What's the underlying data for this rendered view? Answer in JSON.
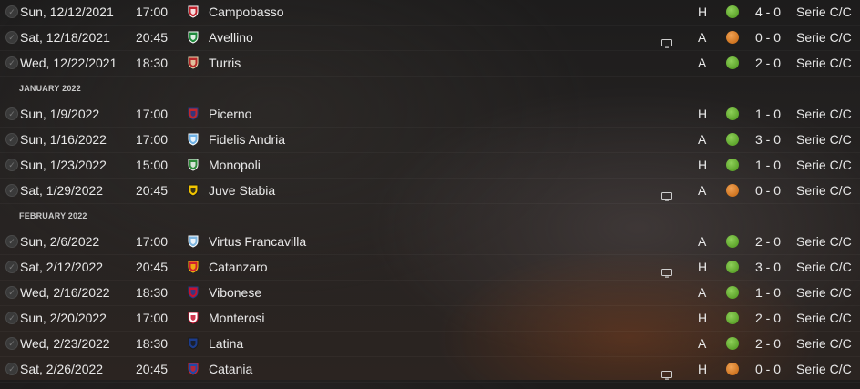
{
  "fixtures": [
    {
      "type": "match",
      "date": "Sun, 12/12/2021",
      "time": "17:00",
      "team": "Campobasso",
      "crest": "crest-campobasso",
      "crest_colors": [
        "#c0222c",
        "#ffffff"
      ],
      "tv": false,
      "venue": "H",
      "result": "win",
      "score": "4 - 0",
      "competition": "Serie C/C"
    },
    {
      "type": "match",
      "date": "Sat, 12/18/2021",
      "time": "20:45",
      "team": "Avellino",
      "crest": "crest-avellino",
      "crest_colors": [
        "#1f8a3c",
        "#ffffff"
      ],
      "tv": true,
      "venue": "A",
      "result": "draw",
      "score": "0 - 0",
      "competition": "Serie C/C"
    },
    {
      "type": "match",
      "date": "Wed, 12/22/2021",
      "time": "18:30",
      "team": "Turris",
      "crest": "crest-turris",
      "crest_colors": [
        "#b52a2a",
        "#e8d9b0"
      ],
      "tv": false,
      "venue": "A",
      "result": "win",
      "score": "2 - 0",
      "competition": "Serie C/C"
    },
    {
      "type": "month",
      "label": "JANUARY 2022"
    },
    {
      "type": "match",
      "date": "Sun, 1/9/2022",
      "time": "17:00",
      "team": "Picerno",
      "crest": "crest-picerno",
      "crest_colors": [
        "#c1272d",
        "#1e3a8a"
      ],
      "tv": false,
      "venue": "H",
      "result": "win",
      "score": "1 - 0",
      "competition": "Serie C/C"
    },
    {
      "type": "match",
      "date": "Sun, 1/16/2022",
      "time": "17:00",
      "team": "Fidelis Andria",
      "crest": "crest-fidelis-andria",
      "crest_colors": [
        "#6fb2e6",
        "#ffffff"
      ],
      "tv": false,
      "venue": "A",
      "result": "win",
      "score": "3 - 0",
      "competition": "Serie C/C"
    },
    {
      "type": "match",
      "date": "Sun, 1/23/2022",
      "time": "15:00",
      "team": "Monopoli",
      "crest": "crest-monopoli",
      "crest_colors": [
        "#2e8b3a",
        "#f2f2f2"
      ],
      "tv": false,
      "venue": "H",
      "result": "win",
      "score": "1 - 0",
      "competition": "Serie C/C"
    },
    {
      "type": "match",
      "date": "Sat, 1/29/2022",
      "time": "20:45",
      "team": "Juve Stabia",
      "crest": "crest-juve-stabia",
      "crest_colors": [
        "#f2c500",
        "#1a1a1a"
      ],
      "tv": true,
      "venue": "A",
      "result": "draw",
      "score": "0 - 0",
      "competition": "Serie C/C"
    },
    {
      "type": "month",
      "label": "FEBRUARY 2022"
    },
    {
      "type": "match",
      "date": "Sun, 2/6/2022",
      "time": "17:00",
      "team": "Virtus Francavilla",
      "crest": "crest-virtus-francavilla",
      "crest_colors": [
        "#7fb6e0",
        "#ffffff"
      ],
      "tv": false,
      "venue": "A",
      "result": "win",
      "score": "2 - 0",
      "competition": "Serie C/C"
    },
    {
      "type": "match",
      "date": "Sat, 2/12/2022",
      "time": "20:45",
      "team": "Catanzaro",
      "crest": "crest-catanzaro",
      "crest_colors": [
        "#d1202f",
        "#f4c20d"
      ],
      "tv": true,
      "venue": "H",
      "result": "win",
      "score": "3 - 0",
      "competition": "Serie C/C"
    },
    {
      "type": "match",
      "date": "Wed, 2/16/2022",
      "time": "18:30",
      "team": "Vibonese",
      "crest": "crest-vibonese",
      "crest_colors": [
        "#c8102e",
        "#1d3f8f"
      ],
      "tv": false,
      "venue": "A",
      "result": "win",
      "score": "1 - 0",
      "competition": "Serie C/C"
    },
    {
      "type": "match",
      "date": "Sun, 2/20/2022",
      "time": "17:00",
      "team": "Monterosi",
      "crest": "crest-monterosi",
      "crest_colors": [
        "#ffffff",
        "#c8102e"
      ],
      "tv": false,
      "venue": "H",
      "result": "win",
      "score": "2 - 0",
      "competition": "Serie C/C"
    },
    {
      "type": "match",
      "date": "Wed, 2/23/2022",
      "time": "18:30",
      "team": "Latina",
      "crest": "crest-latina",
      "crest_colors": [
        "#1c3c8c",
        "#1a1a1a"
      ],
      "tv": false,
      "venue": "A",
      "result": "win",
      "score": "2 - 0",
      "competition": "Serie C/C"
    },
    {
      "type": "match",
      "date": "Sat, 2/26/2022",
      "time": "20:45",
      "team": "Catania",
      "crest": "crest-catania",
      "crest_colors": [
        "#1f4aa8",
        "#d0202a"
      ],
      "tv": true,
      "venue": "H",
      "result": "draw",
      "score": "0 - 0",
      "competition": "Serie C/C"
    }
  ],
  "icons": {
    "checkbox": "circle-check-icon",
    "tv": "tv-icon",
    "result_dot": "result-dot-icon"
  },
  "colors": {
    "win": "#6fba3c",
    "draw": "#e38a34",
    "text": "#e8e8e8",
    "month_header": "#c9c9c9"
  }
}
